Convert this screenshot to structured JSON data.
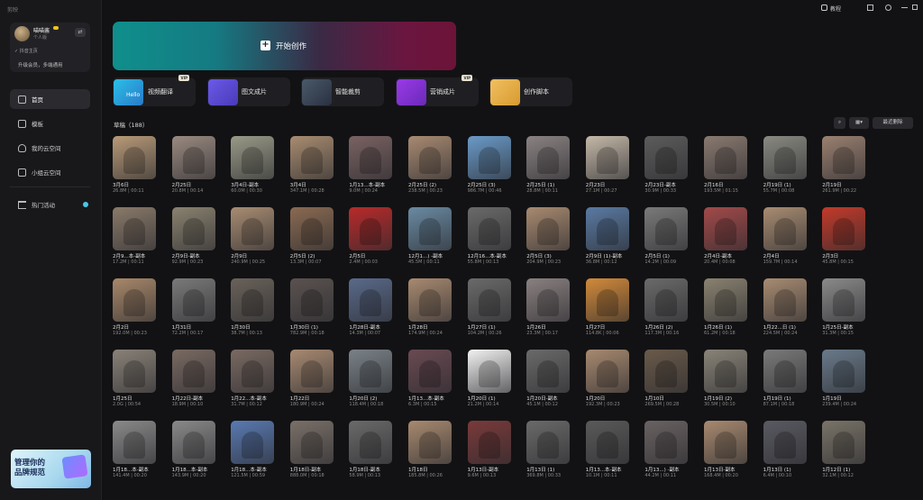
{
  "app": {
    "logo": "剪映"
  },
  "user": {
    "name": "喵喵酱",
    "level": "个人版",
    "home": "抖音主页",
    "upgrade": "升级会员，多端通用"
  },
  "sidebar": {
    "items": [
      {
        "label": "首页",
        "icon": "home-icon",
        "active": true
      },
      {
        "label": "模板",
        "icon": "template-icon",
        "active": false
      },
      {
        "label": "我的云空间",
        "icon": "cloud-icon",
        "active": false
      },
      {
        "label": "小组云空间",
        "icon": "team-cloud-icon",
        "active": false
      },
      {
        "label": "热门活动",
        "icon": "flag-icon",
        "active": false
      }
    ]
  },
  "promo": {
    "line1": "管理你的",
    "line2": "品牌规范"
  },
  "topbar": {
    "tutorial": "教程"
  },
  "hero": {
    "label": "开始创作"
  },
  "tools": [
    {
      "label": "视频翻译",
      "vip": "VIP",
      "thumb_text": "Hello"
    },
    {
      "label": "图文成片",
      "vip": "",
      "thumb_text": ""
    },
    {
      "label": "智能裁剪",
      "vip": "",
      "thumb_text": ""
    },
    {
      "label": "营销成片",
      "vip": "VIP",
      "thumb_text": ""
    },
    {
      "label": "创作脚本",
      "vip": "",
      "thumb_text": ""
    }
  ],
  "drafts": {
    "title": "草稿（188）",
    "recent_delete": "最近删除"
  },
  "colors": {
    "accent": "#4ac8e8",
    "bg": "#121214",
    "sidebar": "#18181b"
  },
  "cards": [
    {
      "name": "3月6日",
      "meta": "26.8M | 00:11",
      "color": "#b89a78"
    },
    {
      "name": "2月25日",
      "meta": "20.8M | 00:14",
      "color": "#9a8a80"
    },
    {
      "name": "3月4日-副本",
      "meta": "60.0M | 00:30",
      "color": "#9a9a88"
    },
    {
      "name": "3月4日",
      "meta": "347.1M | 00:28",
      "color": "#a88c70"
    },
    {
      "name": "1月13...本-副本",
      "meta": "9.0M | 00:24",
      "color": "#7a6262"
    },
    {
      "name": "2月25日 (2)",
      "meta": "238.5M | 00:23",
      "color": "#a88a72"
    },
    {
      "name": "2月25日 (3)",
      "meta": "986.7M | 00:46",
      "color": "#6a9ac8"
    },
    {
      "name": "2月25日 (1)",
      "meta": "28.8M | 00:11",
      "color": "#8a8282"
    },
    {
      "name": "2月23日",
      "meta": "27.1M | 00:27",
      "color": "#c4b8a8"
    },
    {
      "name": "2月23日-副本",
      "meta": "30.9M | 00:33",
      "color": "#5c5c5c"
    },
    {
      "name": "2月16日",
      "meta": "193.5M | 01:15",
      "color": "#8a7a70"
    },
    {
      "name": "2月19日 (1)",
      "meta": "55.7M | 00:08",
      "color": "#8a8a82"
    },
    {
      "name": "2月19日",
      "meta": "261.9M | 00:22",
      "color": "#9a8070"
    },
    {
      "name": "2月9...本-副本",
      "meta": "17.2M | 00:11",
      "color": "#8a7a6a"
    },
    {
      "name": "2月9日-副本",
      "meta": "92.9M | 00:23",
      "color": "#8a8270"
    },
    {
      "name": "2月9日",
      "meta": "240.9M | 00:25",
      "color": "#a88c72"
    },
    {
      "name": "2月5日 (2)",
      "meta": "13.3M | 00:07",
      "color": "#8a6a52"
    },
    {
      "name": "2月5日",
      "meta": "2.4M | 00:03",
      "color": "#b82a2a"
    },
    {
      "name": "12月1...) -副本",
      "meta": "45.5M | 00:11",
      "color": "#6a8aa2"
    },
    {
      "name": "12月16...本-副本",
      "meta": "55.8M | 00:13",
      "color": "#6a6a6a"
    },
    {
      "name": "2月5日 (3)",
      "meta": "204.9M | 00:23",
      "color": "#a88a70"
    },
    {
      "name": "2月9日 (1)-副本",
      "meta": "36.8M | 00:12",
      "color": "#5a7aa2"
    },
    {
      "name": "2月5日 (1)",
      "meta": "14.2M | 00:09",
      "color": "#7a7a7a"
    },
    {
      "name": "2月4日-副本",
      "meta": "20.4M | 00:08",
      "color": "#a24a4a"
    },
    {
      "name": "2月4日",
      "meta": "159.7M | 00:14",
      "color": "#a88c72"
    },
    {
      "name": "2月3日",
      "meta": "45.8M | 00:15",
      "color": "#c23a2a"
    },
    {
      "name": "2月2日",
      "meta": "192.0M | 00:23",
      "color": "#a8886a"
    },
    {
      "name": "1月31日",
      "meta": "72.2M | 00:17",
      "color": "#7a7a7a"
    },
    {
      "name": "1月30日",
      "meta": "38.7M | 00:13",
      "color": "#6a625a"
    },
    {
      "name": "1月30日 (1)",
      "meta": "782.9M | 00:18",
      "color": "#5a5250"
    },
    {
      "name": "1月28日-副本",
      "meta": "14.3M | 00:07",
      "color": "#5a6a8a"
    },
    {
      "name": "1月28日",
      "meta": "174.9M | 00:24",
      "color": "#a88a70"
    },
    {
      "name": "1月27日 (1)",
      "meta": "104.2M | 00:26",
      "color": "#6a6a6a"
    },
    {
      "name": "1月26日",
      "meta": "23.3M | 00:17",
      "color": "#8a8080"
    },
    {
      "name": "1月27日",
      "meta": "114.8K | 00:06",
      "color": "#d28a3a"
    },
    {
      "name": "1月26日 (2)",
      "meta": "117.3M | 00:16",
      "color": "#6a6a6a"
    },
    {
      "name": "1月26日 (1)",
      "meta": "61.2M | 00:18",
      "color": "#8a8270"
    },
    {
      "name": "1月22...日 (1)",
      "meta": "224.5M | 00:24",
      "color": "#a88c72"
    },
    {
      "name": "1月25日-副本",
      "meta": "31.3M | 00:15",
      "color": "#8a8a8a"
    },
    {
      "name": "1月25日",
      "meta": "2.0G | 00:54",
      "color": "#8a8278"
    },
    {
      "name": "1月22日-副本",
      "meta": "18.9M | 00:10",
      "color": "#7a6a62"
    },
    {
      "name": "1月22...本-副本",
      "meta": "31.7M | 00:12",
      "color": "#7a6a62"
    },
    {
      "name": "1月22日",
      "meta": "180.9M | 00:24",
      "color": "#a88a72"
    },
    {
      "name": "1月20日 (2)",
      "meta": "118.4M | 00:18",
      "color": "#7a8288"
    },
    {
      "name": "1月13...本-副本",
      "meta": "6.3M | 00:15",
      "color": "#6a4a52"
    },
    {
      "name": "1月20日 (1)",
      "meta": "21.2M | 00:14",
      "color": "#f2f2f2"
    },
    {
      "name": "1月20日-副本",
      "meta": "45.1M | 00:12",
      "color": "#6a6a6a"
    },
    {
      "name": "1月20日",
      "meta": "192.3M | 00:23",
      "color": "#a88a70"
    },
    {
      "name": "1月10日",
      "meta": "269.5M | 00:28",
      "color": "#6a5a4a"
    },
    {
      "name": "1月19日 (2)",
      "meta": "30.5M | 00:10",
      "color": "#8a8478"
    },
    {
      "name": "1月19日 (1)",
      "meta": "87.1M | 00:18",
      "color": "#7a7a7a"
    },
    {
      "name": "1月19日",
      "meta": "239.4M | 00:24",
      "color": "#6a7a8a"
    },
    {
      "name": "1月18...本-副本",
      "meta": "141.4M | 00:20",
      "color": "#8a8a8a"
    },
    {
      "name": "1月18...本-副本",
      "meta": "143.9M | 00:20",
      "color": "#8a8a8a"
    },
    {
      "name": "1月18...本-副本",
      "meta": "121.5M | 00:59",
      "color": "#5a7ab2"
    },
    {
      "name": "1月18日-副本",
      "meta": "888.0M | 00:18",
      "color": "#7a7068"
    },
    {
      "name": "1月18日-副本",
      "meta": "58.9M | 00:13",
      "color": "#6a6a6a"
    },
    {
      "name": "1月18日",
      "meta": "185.8M | 00:26",
      "color": "#a88a70"
    },
    {
      "name": "1月13日-副本",
      "meta": "9.6M | 00:13",
      "color": "#7a3a3a"
    },
    {
      "name": "1月13日 (1)",
      "meta": "369.8M | 00:33",
      "color": "#6a6a6a"
    },
    {
      "name": "1月13...本-副本",
      "meta": "10.1M | 00:11",
      "color": "#5a5a5a"
    },
    {
      "name": "1月13...) -副本",
      "meta": "44.2M | 00:11",
      "color": "#6a6262"
    },
    {
      "name": "1月13日-副本",
      "meta": "168.4M | 00:20",
      "color": "#a88a70"
    },
    {
      "name": "1月13日 (1)",
      "meta": "6.4M | 00:10",
      "color": "#5a5a62"
    },
    {
      "name": "1月12日 (1)",
      "meta": "32.1M | 00:12",
      "color": "#7a7468"
    }
  ]
}
